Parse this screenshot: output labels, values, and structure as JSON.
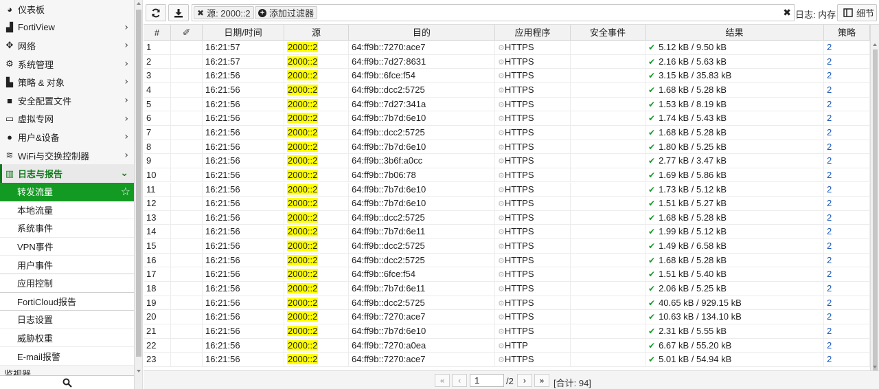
{
  "sidebar": {
    "items": [
      {
        "label": "仪表板",
        "icon": "dashboard-icon",
        "chevron": false
      },
      {
        "label": "FortiView",
        "icon": "chart-icon",
        "chevron": true
      },
      {
        "label": "网络",
        "icon": "network-icon",
        "chevron": true
      },
      {
        "label": "系统管理",
        "icon": "gear-icon",
        "chevron": true
      },
      {
        "label": "策略 & 对象",
        "icon": "policy-icon",
        "chevron": true
      },
      {
        "label": "安全配置文件",
        "icon": "lock-icon",
        "chevron": true
      },
      {
        "label": "虚拟专网",
        "icon": "laptop-icon",
        "chevron": true
      },
      {
        "label": "用户&设备",
        "icon": "user-icon",
        "chevron": true
      },
      {
        "label": "WiFi与交换控制器",
        "icon": "wifi-icon",
        "chevron": true
      }
    ],
    "active_section": {
      "label": "日志与报告",
      "icon": "bar-chart-icon"
    },
    "sub_items": [
      {
        "label": "转发流量",
        "selected": true
      },
      {
        "label": "本地流量"
      },
      {
        "label": "系统事件"
      },
      {
        "label": "VPN事件"
      },
      {
        "label": "用户事件"
      },
      {
        "label": "应用控制"
      },
      {
        "label": "FortiCloud报告"
      },
      {
        "label": "日志设置"
      },
      {
        "label": "威胁权重"
      },
      {
        "label": "E-mail报警"
      }
    ],
    "partial_item": "监视器"
  },
  "toolbar": {
    "filter_chip": "源: 2000::2",
    "add_filter": "添加过滤器",
    "log_source": "日志: 内存",
    "details_label": "细节"
  },
  "table": {
    "columns": [
      "#",
      "",
      "日期/时间",
      "源",
      "目的",
      "应用程序",
      "安全事件",
      "结果",
      "策略"
    ],
    "rows": [
      [
        "1",
        "16:21:57",
        "2000::2",
        "64:ff9b::7270:ace7",
        "HTTPS",
        "5.12 kB / 9.50 kB",
        "2"
      ],
      [
        "2",
        "16:21:57",
        "2000::2",
        "64:ff9b::7d27:8631",
        "HTTPS",
        "2.16 kB / 5.63 kB",
        "2"
      ],
      [
        "3",
        "16:21:56",
        "2000::2",
        "64:ff9b::6fce:f54",
        "HTTPS",
        "3.15 kB / 35.83 kB",
        "2"
      ],
      [
        "4",
        "16:21:56",
        "2000::2",
        "64:ff9b::dcc2:5725",
        "HTTPS",
        "1.68 kB / 5.28 kB",
        "2"
      ],
      [
        "5",
        "16:21:56",
        "2000::2",
        "64:ff9b::7d27:341a",
        "HTTPS",
        "1.53 kB / 8.19 kB",
        "2"
      ],
      [
        "6",
        "16:21:56",
        "2000::2",
        "64:ff9b::7b7d:6e10",
        "HTTPS",
        "1.74 kB / 5.43 kB",
        "2"
      ],
      [
        "7",
        "16:21:56",
        "2000::2",
        "64:ff9b::dcc2:5725",
        "HTTPS",
        "1.68 kB / 5.28 kB",
        "2"
      ],
      [
        "8",
        "16:21:56",
        "2000::2",
        "64:ff9b::7b7d:6e10",
        "HTTPS",
        "1.80 kB / 5.25 kB",
        "2"
      ],
      [
        "9",
        "16:21:56",
        "2000::2",
        "64:ff9b::3b6f:a0cc",
        "HTTPS",
        "2.77 kB / 3.47 kB",
        "2"
      ],
      [
        "10",
        "16:21:56",
        "2000::2",
        "64:ff9b::7b06:78",
        "HTTPS",
        "1.69 kB / 5.86 kB",
        "2"
      ],
      [
        "11",
        "16:21:56",
        "2000::2",
        "64:ff9b::7b7d:6e10",
        "HTTPS",
        "1.73 kB / 5.12 kB",
        "2"
      ],
      [
        "12",
        "16:21:56",
        "2000::2",
        "64:ff9b::7b7d:6e10",
        "HTTPS",
        "1.51 kB / 5.27 kB",
        "2"
      ],
      [
        "13",
        "16:21:56",
        "2000::2",
        "64:ff9b::dcc2:5725",
        "HTTPS",
        "1.68 kB / 5.28 kB",
        "2"
      ],
      [
        "14",
        "16:21:56",
        "2000::2",
        "64:ff9b::7b7d:6e11",
        "HTTPS",
        "1.99 kB / 5.12 kB",
        "2"
      ],
      [
        "15",
        "16:21:56",
        "2000::2",
        "64:ff9b::dcc2:5725",
        "HTTPS",
        "1.49 kB / 6.58 kB",
        "2"
      ],
      [
        "16",
        "16:21:56",
        "2000::2",
        "64:ff9b::dcc2:5725",
        "HTTPS",
        "1.68 kB / 5.28 kB",
        "2"
      ],
      [
        "17",
        "16:21:56",
        "2000::2",
        "64:ff9b::6fce:f54",
        "HTTPS",
        "1.51 kB / 5.40 kB",
        "2"
      ],
      [
        "18",
        "16:21:56",
        "2000::2",
        "64:ff9b::7b7d:6e11",
        "HTTPS",
        "2.06 kB / 5.25 kB",
        "2"
      ],
      [
        "19",
        "16:21:56",
        "2000::2",
        "64:ff9b::dcc2:5725",
        "HTTPS",
        "40.65 kB / 929.15 kB",
        "2"
      ],
      [
        "20",
        "16:21:56",
        "2000::2",
        "64:ff9b::7270:ace7",
        "HTTPS",
        "10.63 kB / 134.10 kB",
        "2"
      ],
      [
        "21",
        "16:21:56",
        "2000::2",
        "64:ff9b::7b7d:6e10",
        "HTTPS",
        "2.31 kB / 5.55 kB",
        "2"
      ],
      [
        "22",
        "16:21:56",
        "2000::2",
        "64:ff9b::7270:a0ea",
        "HTTP",
        "6.67 kB / 55.20 kB",
        "2"
      ],
      [
        "23",
        "16:21:56",
        "2000::2",
        "64:ff9b::7270:ace7",
        "HTTPS",
        "5.01 kB / 54.94 kB",
        "2"
      ]
    ]
  },
  "pager": {
    "current_page": "1",
    "page_total": "/2",
    "total": "[合计: 94]"
  },
  "colors": {
    "accent_green": "#139a22",
    "highlight_yellow": "#ffff00",
    "policy_link": "#1a58b8"
  }
}
